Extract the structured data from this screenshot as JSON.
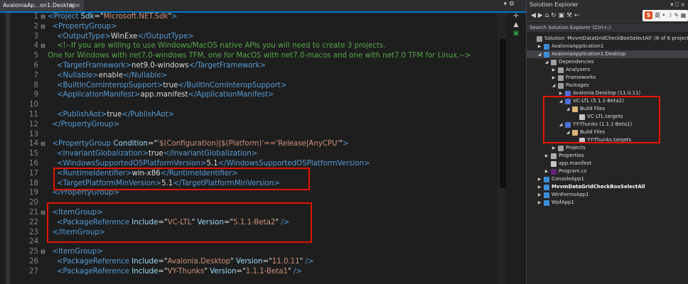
{
  "document_tab": {
    "title": "AvaloniaAp...on1.Desktop",
    "pin_glyph": "⊕",
    "close_glyph": "×"
  },
  "tab_strip_right": {
    "label": "▾ ⚙"
  },
  "side_tools": [
    "✛",
    "▲",
    "▣"
  ],
  "code_lines": [
    {
      "n": "1",
      "fold": "⊟",
      "tokens": [
        [
          "tag",
          "<"
        ],
        [
          "tag",
          "Project "
        ],
        [
          "attr",
          "Sdk"
        ],
        [
          "txt",
          "=\""
        ],
        [
          "str",
          "Microsoft.NET.Sdk"
        ],
        [
          "txt",
          "\""
        ],
        [
          "tag",
          ">"
        ]
      ]
    },
    {
      "n": "2",
      "fold": "⊟",
      "tokens": [
        [
          "txt",
          "  "
        ],
        [
          "tag",
          "<PropertyGroup>"
        ]
      ]
    },
    {
      "n": "3",
      "fold": "",
      "tokens": [
        [
          "txt",
          "    "
        ],
        [
          "tag",
          "<OutputType>"
        ],
        [
          "txt",
          "WinExe"
        ],
        [
          "tag",
          "</OutputType>"
        ]
      ]
    },
    {
      "n": "4",
      "fold": "⊟",
      "tokens": [
        [
          "txt",
          "    "
        ],
        [
          "cmt",
          "<!--If you are willing to use Windows/MacOS native APIs you will need to create 3 projects."
        ]
      ]
    },
    {
      "n": "5",
      "fold": "",
      "tokens": [
        [
          "cmt",
          "One for Windows with net7.0-windows TFM, one for MacOS with net7.0-macos and one with net7.0 TFM for Linux.-->"
        ]
      ]
    },
    {
      "n": "6",
      "fold": "",
      "tokens": [
        [
          "txt",
          "    "
        ],
        [
          "tag",
          "<TargetFramework>"
        ],
        [
          "txt",
          "net9.0-windows"
        ],
        [
          "tag",
          "</TargetFramework>"
        ]
      ]
    },
    {
      "n": "7",
      "fold": "",
      "tokens": [
        [
          "txt",
          "    "
        ],
        [
          "tag",
          "<Nullable>"
        ],
        [
          "txt",
          "enable"
        ],
        [
          "tag",
          "</Nullable>"
        ]
      ]
    },
    {
      "n": "8",
      "fold": "",
      "tokens": [
        [
          "txt",
          "    "
        ],
        [
          "tag",
          "<BuiltInComInteropSupport>"
        ],
        [
          "txt",
          "true"
        ],
        [
          "tag",
          "</BuiltInComInteropSupport>"
        ]
      ]
    },
    {
      "n": "9",
      "fold": "",
      "tokens": [
        [
          "txt",
          "    "
        ],
        [
          "tag",
          "<ApplicationManifest>"
        ],
        [
          "txt",
          "app.manifest"
        ],
        [
          "tag",
          "</ApplicationManifest>"
        ]
      ]
    },
    {
      "n": "10",
      "fold": "",
      "tokens": []
    },
    {
      "n": "11",
      "fold": "",
      "tokens": [
        [
          "txt",
          "    "
        ],
        [
          "tag",
          "<PublishAot>"
        ],
        [
          "txt",
          "true"
        ],
        [
          "tag",
          "</PublishAot>"
        ]
      ]
    },
    {
      "n": "12",
      "fold": "",
      "tokens": [
        [
          "txt",
          "  "
        ],
        [
          "tag",
          "</PropertyGroup>"
        ]
      ]
    },
    {
      "n": "13",
      "fold": "",
      "tokens": []
    },
    {
      "n": "14",
      "fold": "⊟",
      "tokens": [
        [
          "txt",
          "  "
        ],
        [
          "tag",
          "<PropertyGroup "
        ],
        [
          "attr",
          "Condition"
        ],
        [
          "txt",
          "=\""
        ],
        [
          "str",
          "'$(Configuration)|$(Platform)'=='Release|AnyCPU'"
        ],
        [
          "txt",
          "\""
        ],
        [
          "tag",
          ">"
        ]
      ]
    },
    {
      "n": "15",
      "fold": "",
      "tokens": [
        [
          "txt",
          "    "
        ],
        [
          "tag",
          "<InvariantGlobalization>"
        ],
        [
          "txt",
          "true"
        ],
        [
          "tag",
          "</InvariantGlobalization>"
        ]
      ]
    },
    {
      "n": "16",
      "fold": "",
      "tokens": [
        [
          "txt",
          "    "
        ],
        [
          "tag",
          "<WindowsSupportedOSPlatformVersion>"
        ],
        [
          "txt",
          "5.1"
        ],
        [
          "tag",
          "</WindowsSupportedOSPlatformVersion>"
        ]
      ]
    },
    {
      "n": "17",
      "fold": "",
      "tokens": [
        [
          "txt",
          "    "
        ],
        [
          "tag",
          "<RuntimeIdentifier>"
        ],
        [
          "txt",
          "win-x86"
        ],
        [
          "tag",
          "</RuntimeIdentifier>"
        ]
      ]
    },
    {
      "n": "18",
      "fold": "",
      "tokens": [
        [
          "txt",
          "    "
        ],
        [
          "tag",
          "<TargetPlatformMinVersion>"
        ],
        [
          "txt",
          "5.1"
        ],
        [
          "tag",
          "</TargetPlatformMinVersion>"
        ]
      ]
    },
    {
      "n": "19",
      "fold": "",
      "tokens": [
        [
          "txt",
          "  "
        ],
        [
          "tag",
          "</PropertyGroup>"
        ]
      ]
    },
    {
      "n": "20",
      "fold": "",
      "tokens": []
    },
    {
      "n": "21",
      "fold": "⊟",
      "tokens": [
        [
          "txt",
          "  "
        ],
        [
          "tag",
          "<ItemGroup>"
        ]
      ]
    },
    {
      "n": "22",
      "fold": "",
      "tokens": [
        [
          "txt",
          "    "
        ],
        [
          "tag",
          "<PackageReference "
        ],
        [
          "attr",
          "Include"
        ],
        [
          "txt",
          "=\""
        ],
        [
          "str",
          "VC-LTL"
        ],
        [
          "txt",
          "\" "
        ],
        [
          "attr",
          "Version"
        ],
        [
          "txt",
          "=\""
        ],
        [
          "str",
          "5.1.1-Beta2"
        ],
        [
          "txt",
          "\" "
        ],
        [
          "tag",
          "/>"
        ]
      ]
    },
    {
      "n": "23",
      "fold": "",
      "tokens": [
        [
          "txt",
          "  "
        ],
        [
          "tag",
          "</ItemGroup>"
        ]
      ]
    },
    {
      "n": "24",
      "fold": "",
      "tokens": []
    },
    {
      "n": "25",
      "fold": "⊟",
      "tokens": [
        [
          "txt",
          "  "
        ],
        [
          "tag",
          "<ItemGroup>"
        ]
      ]
    },
    {
      "n": "26",
      "fold": "",
      "tokens": [
        [
          "txt",
          "    "
        ],
        [
          "tag",
          "<PackageReference "
        ],
        [
          "attr",
          "Include"
        ],
        [
          "txt",
          "=\""
        ],
        [
          "str",
          "Avalonia.Desktop"
        ],
        [
          "txt",
          "\" "
        ],
        [
          "attr",
          "Version"
        ],
        [
          "txt",
          "=\""
        ],
        [
          "str",
          "11.0.11"
        ],
        [
          "txt",
          "\" "
        ],
        [
          "tag",
          "/>"
        ]
      ]
    },
    {
      "n": "27",
      "fold": "",
      "tokens": [
        [
          "txt",
          "    "
        ],
        [
          "tag",
          "<PackageReference "
        ],
        [
          "attr",
          "Include"
        ],
        [
          "txt",
          "=\""
        ],
        [
          "str",
          "VY-Thunks"
        ],
        [
          "txt",
          "\" "
        ],
        [
          "attr",
          "Version"
        ],
        [
          "txt",
          "=\""
        ],
        [
          "str",
          "1.1.1-Beta1"
        ],
        [
          "txt",
          "\" "
        ],
        [
          "tag",
          "/>"
        ]
      ]
    }
  ],
  "solution_explorer": {
    "title": "Solution Explorer",
    "window_controls": "▾ ⎕ ×",
    "toolbar_icons": "◀ ▶ ⌂ ↻ ▣ ⚒ ←",
    "ime_badge": {
      "logo": "S",
      "label": "英 • ☽ ✎ ▦"
    },
    "search_placeholder": "Search Solution Explorer (Ctrl+;)",
    "items": [
      {
        "depth": 0,
        "arrow": "",
        "icon": "solution",
        "label": "Solution 'MvvmDataGridCheckBoxSelectAll' (6 of 6 projects)",
        "bold": false,
        "selected": false
      },
      {
        "depth": 1,
        "arrow": "▶",
        "icon": "project",
        "label": "AvaloniaApplication1",
        "bold": false,
        "selected": false
      },
      {
        "depth": 1,
        "arrow": "◢",
        "icon": "project",
        "label": "AvaloniaApplication1.Desktop",
        "bold": false,
        "selected": true
      },
      {
        "depth": 2,
        "arrow": "◢",
        "icon": "deps",
        "label": "Dependencies",
        "bold": false,
        "selected": false
      },
      {
        "depth": 3,
        "arrow": "▶",
        "icon": "deps",
        "label": "Analyzers",
        "bold": false,
        "selected": false
      },
      {
        "depth": 3,
        "arrow": "▶",
        "icon": "deps",
        "label": "Frameworks",
        "bold": false,
        "selected": false
      },
      {
        "depth": 3,
        "arrow": "◢",
        "icon": "deps",
        "label": "Packages",
        "bold": false,
        "selected": false
      },
      {
        "depth": 4,
        "arrow": "▶",
        "icon": "pkg",
        "label": "Avalonia.Desktop (11.0.11)",
        "bold": false,
        "selected": false
      },
      {
        "depth": 4,
        "arrow": "◢",
        "icon": "pkg",
        "label": "VC-LTL (5.1.1-Beta2)",
        "bold": false,
        "selected": false
      },
      {
        "depth": 5,
        "arrow": "◢",
        "icon": "folder",
        "label": "Build Files",
        "bold": false,
        "selected": false
      },
      {
        "depth": 6,
        "arrow": "",
        "icon": "file",
        "label": "VC-LTL.targets",
        "bold": false,
        "selected": false
      },
      {
        "depth": 4,
        "arrow": "◢",
        "icon": "pkg",
        "label": "YY-Thunks (1.1.1-Beta1)",
        "bold": false,
        "selected": false
      },
      {
        "depth": 5,
        "arrow": "◢",
        "icon": "folder",
        "label": "Build Files",
        "bold": false,
        "selected": false
      },
      {
        "depth": 6,
        "arrow": "",
        "icon": "file",
        "label": "YY-Thunks.targets",
        "bold": false,
        "selected": false
      },
      {
        "depth": 3,
        "arrow": "▶",
        "icon": "deps",
        "label": "Projects",
        "bold": false,
        "selected": false
      },
      {
        "depth": 2,
        "arrow": "▶",
        "icon": "props",
        "label": "Properties",
        "bold": false,
        "selected": false
      },
      {
        "depth": 2,
        "arrow": "",
        "icon": "file",
        "label": "app.manifest",
        "bold": false,
        "selected": false
      },
      {
        "depth": 2,
        "arrow": "▶",
        "icon": "cs",
        "label": "Program.cs",
        "bold": false,
        "selected": false
      },
      {
        "depth": 1,
        "arrow": "▶",
        "icon": "project",
        "label": "ConsoleApp1",
        "bold": false,
        "selected": false
      },
      {
        "depth": 1,
        "arrow": "▶",
        "icon": "project",
        "label": "MvvmDataGridCheckBoxSelectAll",
        "bold": true,
        "selected": false
      },
      {
        "depth": 1,
        "arrow": "▶",
        "icon": "project",
        "label": "WinFormsApp1",
        "bold": false,
        "selected": false
      },
      {
        "depth": 1,
        "arrow": "▶",
        "icon": "project",
        "label": "WpfApp1",
        "bold": false,
        "selected": false
      }
    ]
  },
  "colors": {
    "solution": "#9b9b9b",
    "project": "#3c8dd6",
    "deps": "#a0a0a0",
    "pkg": "#4f6fd6",
    "folder": "#dcb67a",
    "file": "#c8c8c8",
    "props": "#b0b0b0",
    "cs": "#68217a",
    "highlight": "#e51400"
  }
}
